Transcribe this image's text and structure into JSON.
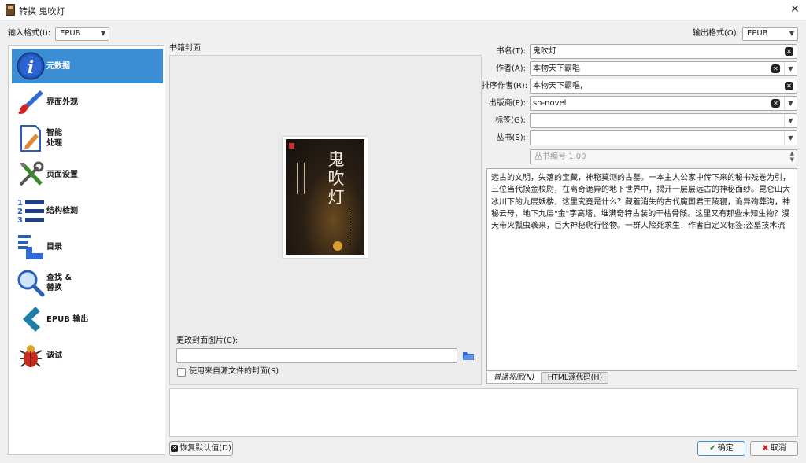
{
  "window": {
    "title": "转换 鬼吹灯"
  },
  "top": {
    "input_format_label": "输入格式(I):",
    "input_format_value": "EPUB",
    "output_format_label": "输出格式(O):",
    "output_format_value": "EPUB"
  },
  "sidebar": {
    "items": [
      {
        "label": "元数据",
        "icon": "info-icon",
        "selected": true
      },
      {
        "label": "界面外观",
        "icon": "paintbrush-icon"
      },
      {
        "label": "智能",
        "label2": "处理",
        "icon": "document-pen-icon"
      },
      {
        "label": "页面设置",
        "icon": "tools-icon"
      },
      {
        "label": "结构检测",
        "icon": "numbered-list-icon"
      },
      {
        "label": "目录",
        "icon": "toc-icon"
      },
      {
        "label": "查找 &",
        "label2": "替换",
        "icon": "magnifier-icon"
      },
      {
        "label": "EPUB 输出",
        "icon": "chevron-left-icon"
      },
      {
        "label": "调试",
        "icon": "bug-icon"
      }
    ]
  },
  "cover": {
    "section_label": "书籍封面",
    "book_title_art": "鬼吹灯",
    "change_label": "更改封面图片(C):",
    "path_value": "",
    "use_source_label": "使用来自源文件的封面(S)"
  },
  "metadata": {
    "title_label": "书名(T):",
    "title_value": "鬼吹灯",
    "author_label": "作者(A):",
    "author_value": "本物天下霸唱",
    "author_sort_label": "排序作者(R):",
    "author_sort_value": "本物天下霸唱,",
    "publisher_label": "出版商(P):",
    "publisher_value": "so-novel",
    "tags_label": "标签(G):",
    "tags_value": "",
    "series_label": "丛书(S):",
    "series_value": "",
    "series_index_placeholder": "丛书编号 1.00",
    "description": "远古的文明，失落的宝藏，神秘莫测的古墓。一本主人公家中传下来的秘书残卷为引，三位当代摸金校尉，在离奇诡异的地下世界中，揭开一层层远古的神秘面纱。昆仑山大冰川下的九层妖楼，这里究竟是什么？藏着消失的古代魔国君王陵寝，诡异殉葬沟，神秘云母，地下九层\"金\"字高塔，堆满奇特古装的干枯骨骸。这里又有那些未知生物？漫天带火瓢虫袭来，巨大神秘爬行怪物。一群人险死求生！作者自定义标签:盗墓技术流",
    "tab_normal": "普通视图(N)",
    "tab_html": "HTML源代码(H)"
  },
  "buttons": {
    "restore": "恢复默认值(D)",
    "ok": "确定",
    "cancel": "取消"
  },
  "colors": {
    "accent": "#3c8ed4",
    "selected_bg": "#3c8ed4"
  }
}
